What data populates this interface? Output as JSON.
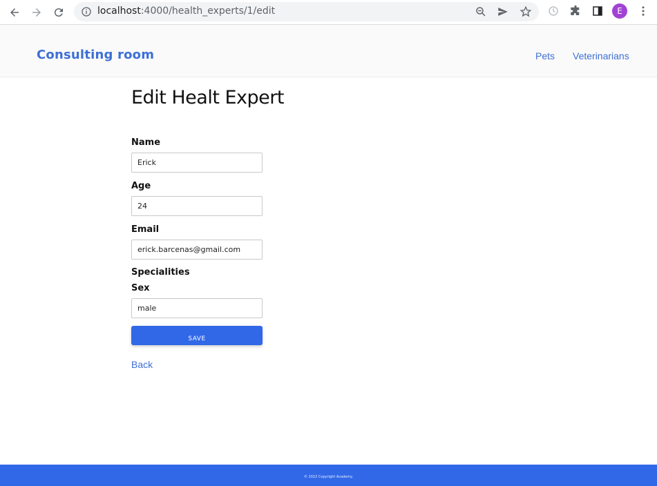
{
  "browser": {
    "url_host": "localhost",
    "url_path": ":4000/health_experts/1/edit",
    "profile_initial": "E"
  },
  "header": {
    "brand": "Consulting room",
    "nav": [
      {
        "label": "Pets"
      },
      {
        "label": "Veterinarians"
      }
    ]
  },
  "page": {
    "title": "Edit Healt Expert"
  },
  "form": {
    "name_label": "Name",
    "name_value": "Erick",
    "age_label": "Age",
    "age_value": "24",
    "email_label": "Email",
    "email_value": "erick.barcenas@gmail.com",
    "specialities_label": "Specialities",
    "sex_label": "Sex",
    "sex_value": "male",
    "save_label": "SAVE"
  },
  "back_label": "Back",
  "footer": {
    "copyright": "© 2022 Copyright Academy."
  },
  "colors": {
    "accent": "#3168e8",
    "brand": "#3d6fd6",
    "avatar": "#a142d4"
  }
}
